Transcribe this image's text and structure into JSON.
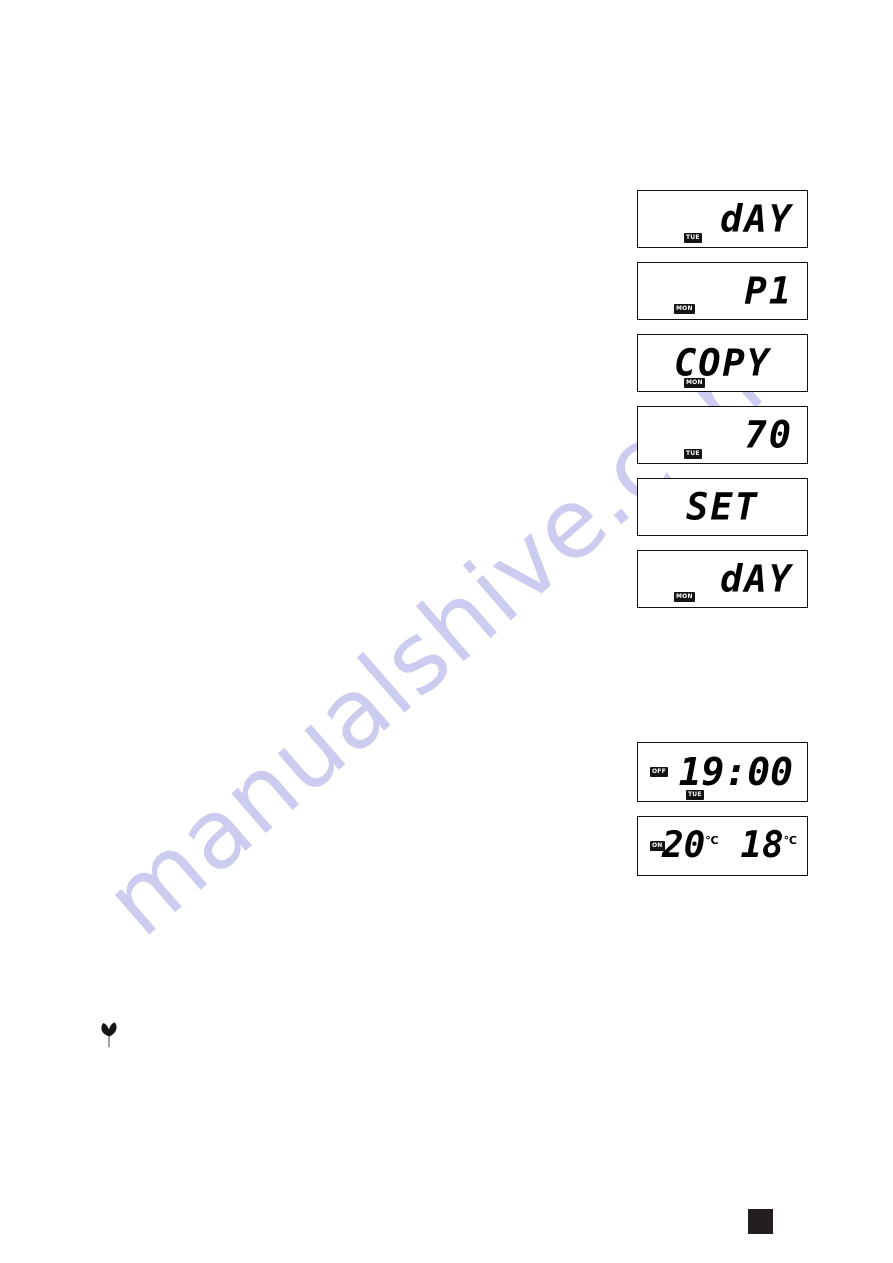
{
  "watermark": {
    "text": "manualshive.com"
  },
  "lcd_panels_group_one": [
    {
      "name": "day",
      "value": "dAY",
      "badge": "TUE",
      "badge_position": "bottom-left",
      "align": "right"
    },
    {
      "name": "program",
      "value": "P1",
      "badge": "MON",
      "badge_position": "bottom-left2",
      "align": "right"
    },
    {
      "name": "copy",
      "value": "COPY",
      "badge": "MON",
      "badge_position": "bottom-mid",
      "align": "center"
    },
    {
      "name": "temperature",
      "value": "70",
      "badge": "TUE",
      "badge_position": "bottom-left",
      "align": "right"
    },
    {
      "name": "set",
      "value": "SET",
      "badge": "",
      "badge_position": "none",
      "align": "center"
    },
    {
      "name": "day-confirm",
      "value": "dAY",
      "badge": "MON",
      "badge_position": "bottom-left2",
      "align": "right"
    }
  ],
  "lcd_panels_group_two": [
    {
      "name": "time",
      "value": "19:00",
      "left_badge": "OFF",
      "bottom_badge": "TUE"
    },
    {
      "name": "temperature-pair",
      "value_one": "20",
      "unit_one": "℃",
      "value_two": "18",
      "unit_two": "℃",
      "left_badge": "ON",
      "bottom_badge": ""
    }
  ],
  "icons": {
    "leaf": "leaf-icon"
  },
  "page_marker": {
    "label": ""
  },
  "colors": {
    "lcd_border": "#111111",
    "lcd_digit": "#000000",
    "badge_background": "#141414",
    "watermark": "#ccccf0",
    "page_marker": "#231f20",
    "page_background": "#ffffff"
  }
}
